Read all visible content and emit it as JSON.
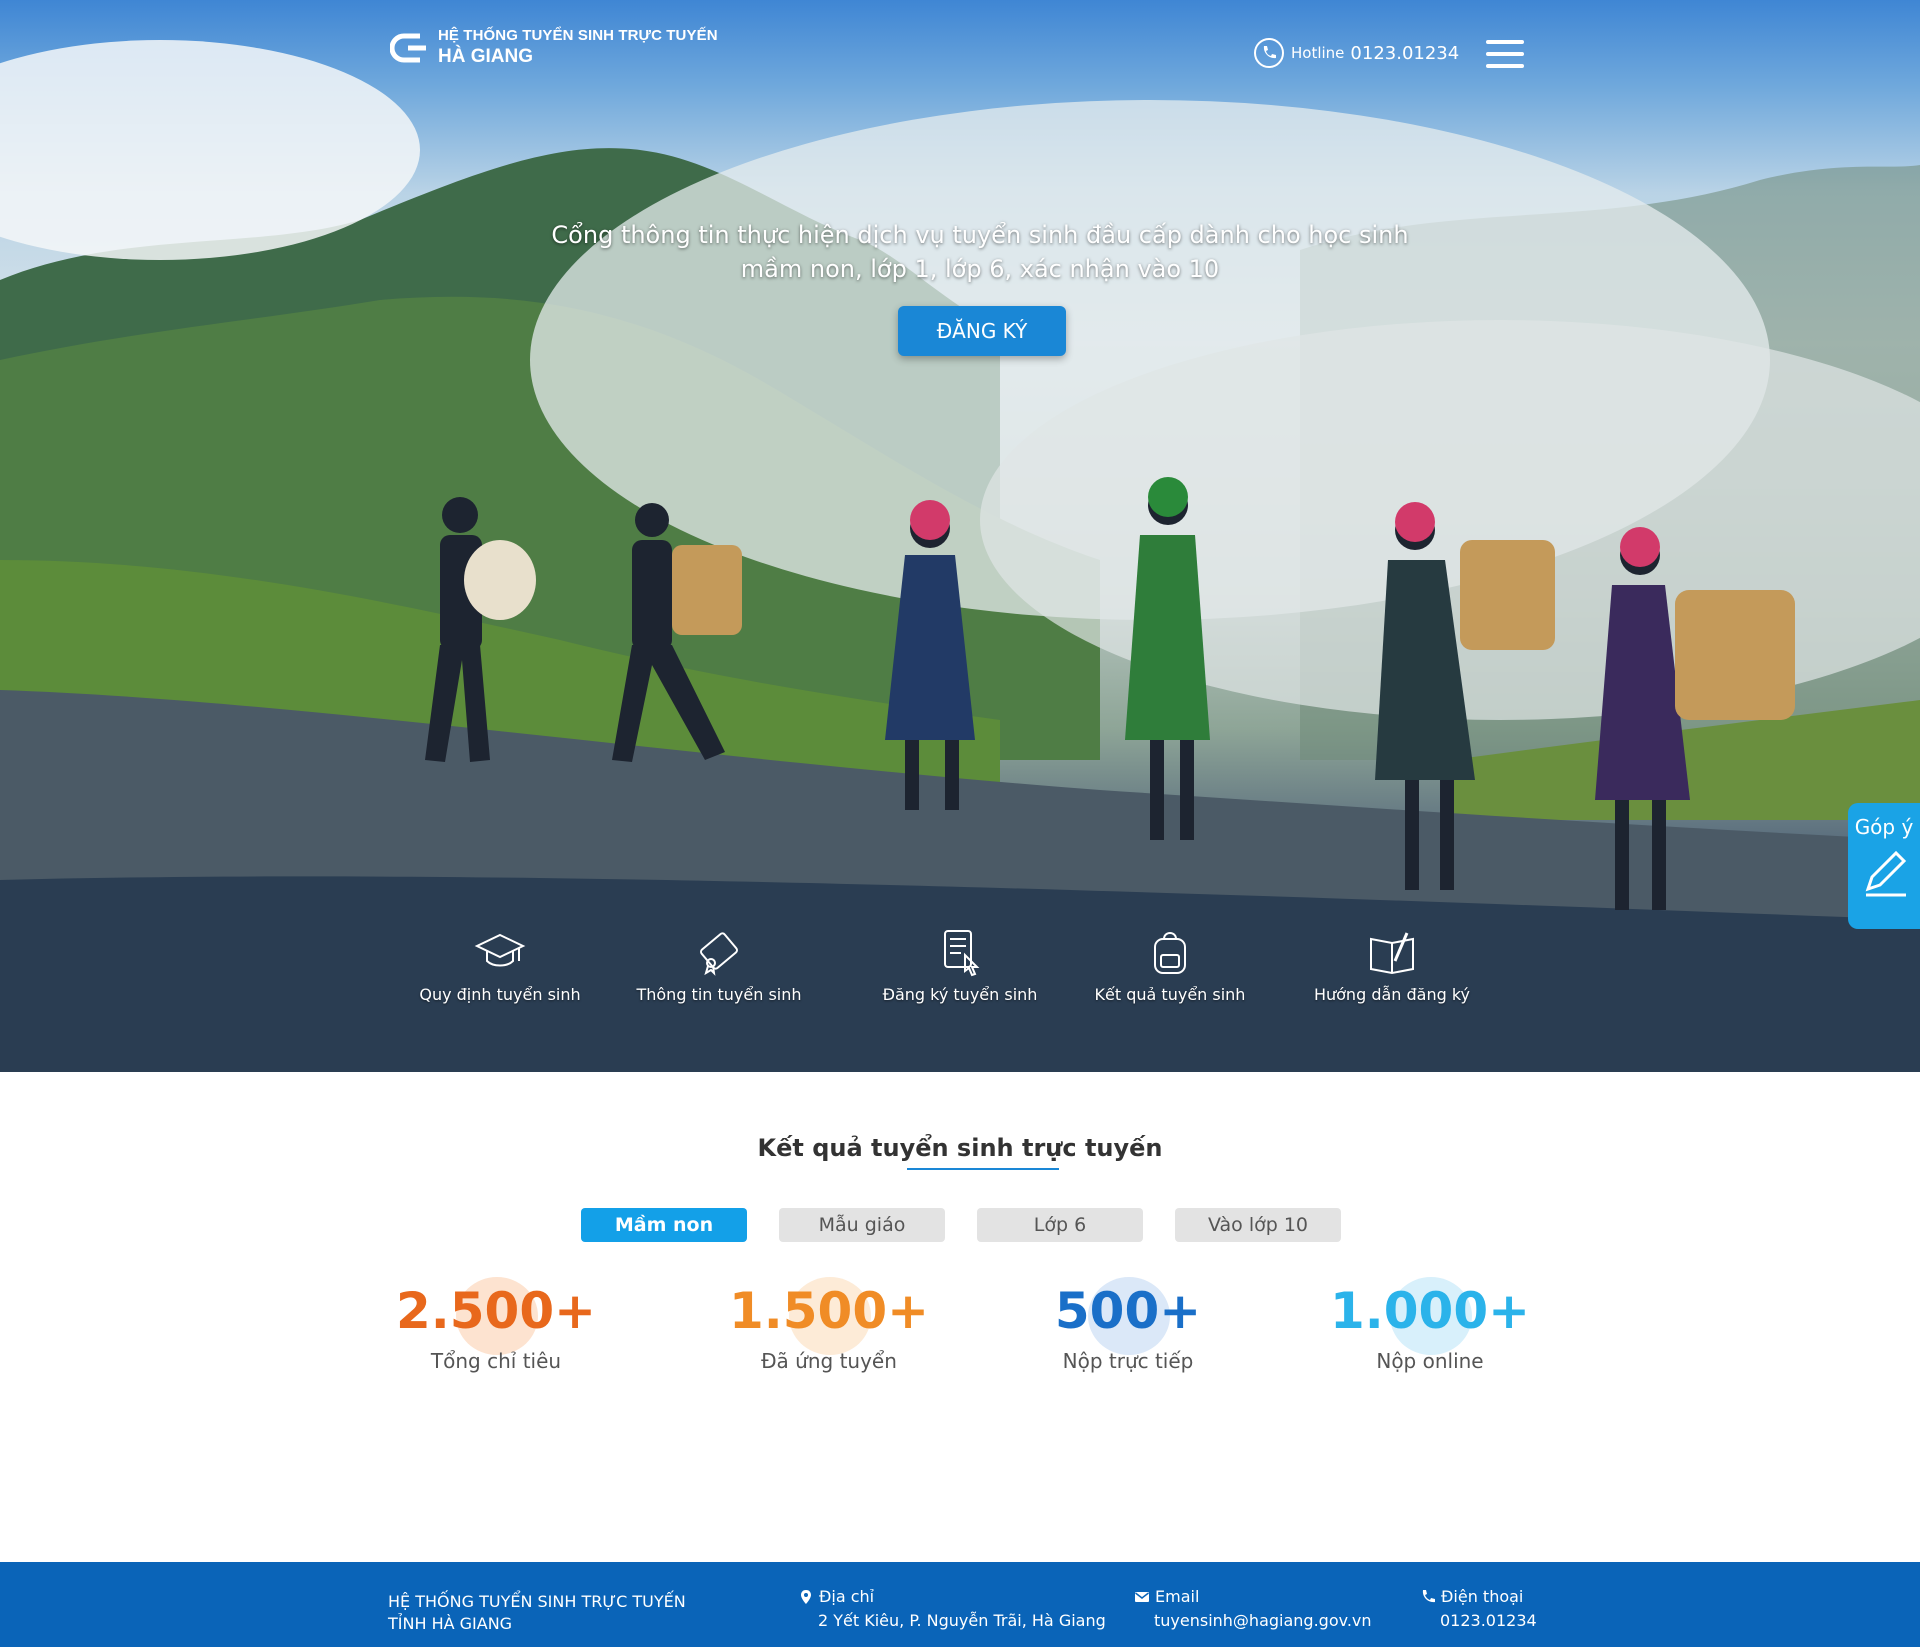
{
  "header": {
    "logo_line1": "HỆ THỐNG TUYỂN SINH TRỰC TUYẾN",
    "logo_line2": "HÀ GIANG",
    "hotline_label": "Hotline",
    "hotline_number": "0123.01234"
  },
  "hero": {
    "tagline_line1": "Cổng thông tin thực hiện dịch vụ tuyển sinh đầu cấp dành cho học sinh",
    "tagline_line2": "mầm non, lớp 1, lớp 6, xác nhận vào 10",
    "register_label": "ĐĂNG KÝ",
    "quicklinks": [
      {
        "label": "Quy định tuyển sinh",
        "icon": "graduation-cap-icon"
      },
      {
        "label": "Thông tin  tuyển sinh",
        "icon": "diploma-scroll-icon"
      },
      {
        "label": "Đăng ký tuyển sinh",
        "icon": "checklist-pointer-icon"
      },
      {
        "label": "Kết quả tuyển sinh",
        "icon": "backpack-icon"
      },
      {
        "label": "Hướng dẫn đăng ký",
        "icon": "book-pencil-icon"
      }
    ]
  },
  "feedback": {
    "label": "Góp ý",
    "icon": "pencil-icon"
  },
  "results": {
    "title": "Kết quả tuyển sinh trực tuyến",
    "tabs": [
      {
        "label": "Mầm non",
        "active": true
      },
      {
        "label": "Mẫu giáo",
        "active": false
      },
      {
        "label": "Lớp 6",
        "active": false
      },
      {
        "label": "Vào lớp 10",
        "active": false
      }
    ],
    "stats": [
      {
        "value": "2.500+",
        "label": "Tổng chỉ tiêu",
        "color": "#e8681c",
        "blob": "#fde3d0"
      },
      {
        "value": "1.500+",
        "label": "Đã ứng tuyển",
        "color": "#f08c26",
        "blob": "#fdebd7"
      },
      {
        "value": "500+",
        "label": "Nộp trực tiếp",
        "color": "#1a6fc8",
        "blob": "#dbe8f8"
      },
      {
        "value": "1.000+",
        "label": "Nộp online",
        "color": "#2bb3ea",
        "blob": "#d8f0fb"
      }
    ]
  },
  "footer": {
    "brand_line1": "HỆ THỐNG TUYỂN SINH TRỰC TUYẾN",
    "brand_line2": "TỈNH HÀ GIANG",
    "address_label": "Địa chỉ",
    "address_value": "2 Yết Kiêu, P. Nguyễn Trãi, Hà Giang",
    "email_label": "Email",
    "email_value": "tuyensinh@hagiang.gov.vn",
    "phone_label": "Điện thoại",
    "phone_value": "0123.01234"
  },
  "colors": {
    "primary": "#1a87d6",
    "tab_active": "#13a0e8",
    "footer": "#0a64b8",
    "feedback": "#1aa3e6"
  }
}
